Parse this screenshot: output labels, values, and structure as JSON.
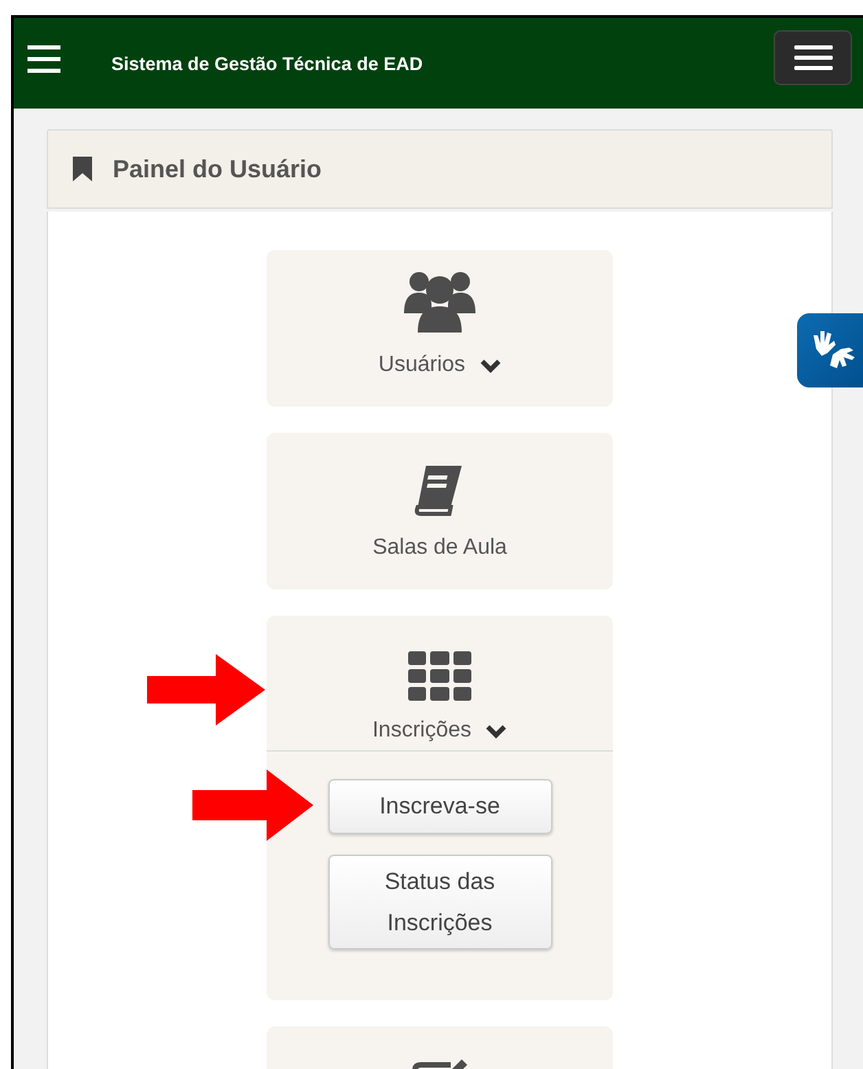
{
  "header": {
    "title": "Sistema de Gestão Técnica de EAD"
  },
  "panel": {
    "title": "Painel do Usuário",
    "tiles": [
      {
        "label": "Usuários",
        "has_menu": true,
        "expanded": false,
        "pointed": false
      },
      {
        "label": "Salas de Aula",
        "has_menu": false,
        "expanded": false,
        "pointed": false
      },
      {
        "label": "Inscrições",
        "has_menu": true,
        "expanded": true,
        "pointed": true,
        "children": [
          {
            "label": "Inscreva-se",
            "pointed": true
          },
          {
            "label": "Status das Inscrições",
            "pointed": false
          }
        ]
      },
      {
        "pointed": false
      }
    ]
  }
}
